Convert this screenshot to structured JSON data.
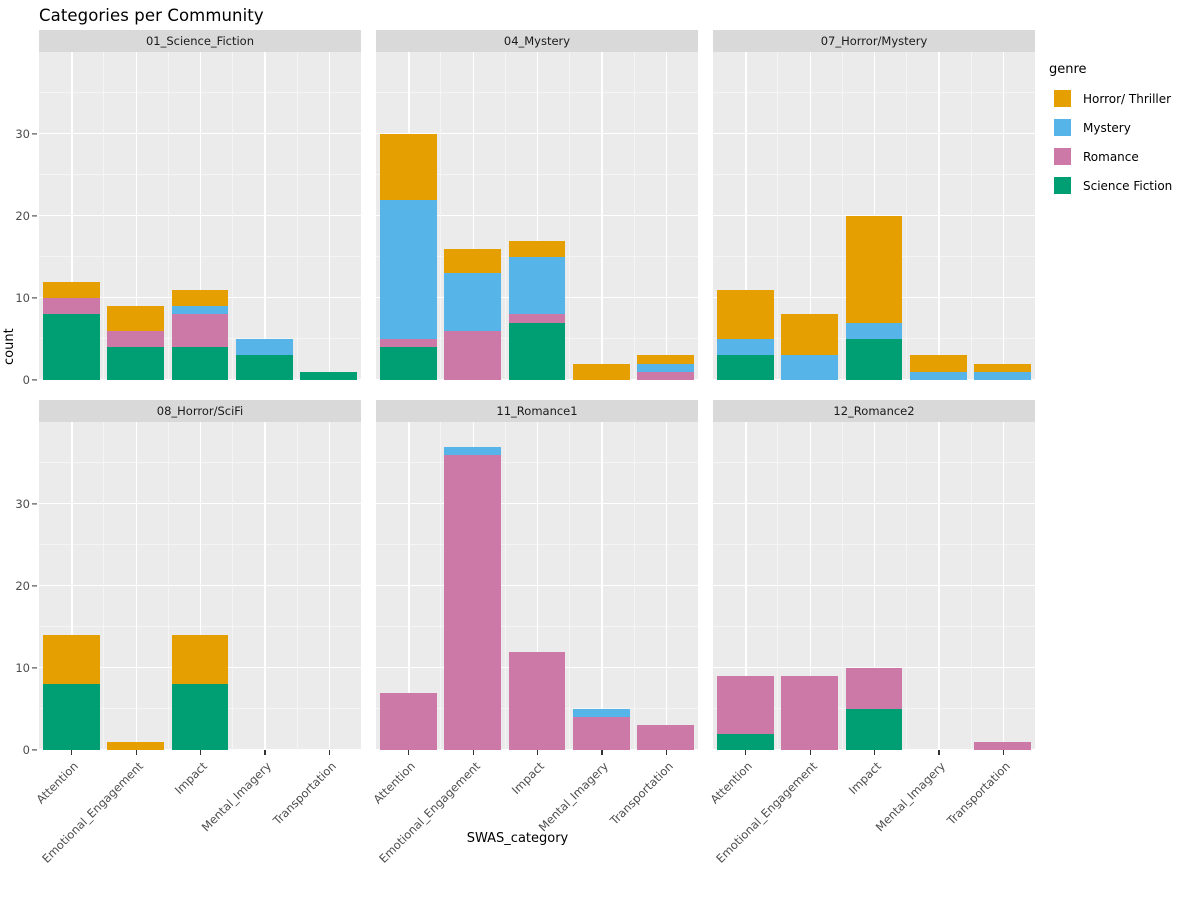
{
  "title": "Categories per Community",
  "axis": {
    "x_title": "SWAS_category",
    "y_title": "count",
    "y_ticks": [
      "0",
      "10",
      "20",
      "30"
    ],
    "y_tick_values": [
      0,
      10,
      20,
      30
    ],
    "x_tick_labels": [
      "Attention",
      "Emotional_Engagement",
      "Impact",
      "Mental_Imagery",
      "Transportation"
    ]
  },
  "legend": {
    "title": "genre",
    "items": [
      {
        "label": "Horror/ Thriller",
        "color": "#E69F00"
      },
      {
        "label": "Mystery",
        "color": "#56B4E9"
      },
      {
        "label": "Romance",
        "color": "#CC79A7"
      },
      {
        "label": "Science Fiction",
        "color": "#009E73"
      }
    ]
  },
  "panels": [
    {
      "title": "01_Science_Fiction"
    },
    {
      "title": "04_Mystery"
    },
    {
      "title": "07_Horror/Mystery"
    },
    {
      "title": "08_Horror/SciFi"
    },
    {
      "title": "11_Romance1"
    },
    {
      "title": "12_Romance2"
    }
  ],
  "chart_data": {
    "type": "bar",
    "subtype": "stacked-bar-faceted",
    "title": "Categories per Community",
    "xlabel": "SWAS_category",
    "ylabel": "count",
    "ylim": [
      0,
      40
    ],
    "y_ticks": [
      0,
      10,
      20,
      30
    ],
    "grid": true,
    "legend_title": "genre",
    "legend_position": "right",
    "categories": [
      "Attention",
      "Emotional_Engagement",
      "Impact",
      "Mental_Imagery",
      "Transportation"
    ],
    "stack_order_bottom_to_top": [
      "Science Fiction",
      "Romance",
      "Mystery",
      "Horror/ Thriller"
    ],
    "colors": {
      "Horror/ Thriller": "#E69F00",
      "Mystery": "#56B4E9",
      "Romance": "#CC79A7",
      "Science Fiction": "#009E73"
    },
    "facets": [
      {
        "name": "01_Science_Fiction",
        "series": [
          {
            "name": "Science Fiction",
            "values": [
              8,
              4,
              4,
              3,
              1
            ]
          },
          {
            "name": "Romance",
            "values": [
              2,
              2,
              4,
              0,
              0
            ]
          },
          {
            "name": "Mystery",
            "values": [
              0,
              0,
              1,
              2,
              0
            ]
          },
          {
            "name": "Horror/ Thriller",
            "values": [
              2,
              3,
              2,
              0,
              0
            ]
          }
        ],
        "totals": [
          12,
          9,
          11,
          5,
          1
        ]
      },
      {
        "name": "04_Mystery",
        "series": [
          {
            "name": "Science Fiction",
            "values": [
              4,
              0,
              7,
              0,
              0
            ]
          },
          {
            "name": "Romance",
            "values": [
              1,
              6,
              1,
              0,
              1
            ]
          },
          {
            "name": "Mystery",
            "values": [
              17,
              7,
              7,
              0,
              1
            ]
          },
          {
            "name": "Horror/ Thriller",
            "values": [
              8,
              3,
              2,
              2,
              1
            ]
          }
        ],
        "totals": [
          30,
          16,
          17,
          2,
          3
        ]
      },
      {
        "name": "07_Horror/Mystery",
        "series": [
          {
            "name": "Science Fiction",
            "values": [
              3,
              0,
              5,
              0,
              0
            ]
          },
          {
            "name": "Romance",
            "values": [
              0,
              0,
              0,
              0,
              0
            ]
          },
          {
            "name": "Mystery",
            "values": [
              2,
              3,
              2,
              1,
              1
            ]
          },
          {
            "name": "Horror/ Thriller",
            "values": [
              6,
              5,
              13,
              2,
              1
            ]
          }
        ],
        "totals": [
          11,
          8,
          20,
          3,
          2
        ]
      },
      {
        "name": "08_Horror/SciFi",
        "series": [
          {
            "name": "Science Fiction",
            "values": [
              8,
              0,
              8,
              0,
              0
            ]
          },
          {
            "name": "Romance",
            "values": [
              0,
              0,
              0,
              0,
              0
            ]
          },
          {
            "name": "Mystery",
            "values": [
              0,
              0,
              0,
              0,
              0
            ]
          },
          {
            "name": "Horror/ Thriller",
            "values": [
              6,
              1,
              6,
              0,
              0
            ]
          }
        ],
        "totals": [
          14,
          1,
          14,
          0,
          0
        ]
      },
      {
        "name": "11_Romance1",
        "series": [
          {
            "name": "Science Fiction",
            "values": [
              0,
              0,
              0,
              0,
              0
            ]
          },
          {
            "name": "Romance",
            "values": [
              7,
              36,
              12,
              4,
              3
            ]
          },
          {
            "name": "Mystery",
            "values": [
              0,
              1,
              0,
              1,
              0
            ]
          },
          {
            "name": "Horror/ Thriller",
            "values": [
              0,
              0,
              0,
              0,
              0
            ]
          }
        ],
        "totals": [
          7,
          37,
          12,
          5,
          3
        ]
      },
      {
        "name": "12_Romance2",
        "series": [
          {
            "name": "Science Fiction",
            "values": [
              2,
              0,
              5,
              0,
              0
            ]
          },
          {
            "name": "Romance",
            "values": [
              7,
              9,
              5,
              0,
              1
            ]
          },
          {
            "name": "Mystery",
            "values": [
              0,
              0,
              0,
              0,
              0
            ]
          },
          {
            "name": "Horror/ Thriller",
            "values": [
              0,
              0,
              0,
              0,
              0
            ]
          }
        ],
        "totals": [
          9,
          9,
          10,
          0,
          1
        ]
      }
    ]
  }
}
